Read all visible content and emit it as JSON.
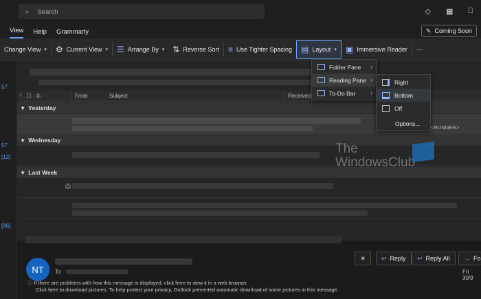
{
  "search": {
    "placeholder": "Search"
  },
  "menubar": {
    "items": [
      "View",
      "Help",
      "Grammarly"
    ],
    "coming_soon": "Coming Soon"
  },
  "ribbon": {
    "change_view": "Change View",
    "current_view": "Current View",
    "arrange_by": "Arrange By",
    "reverse_sort": "Reverse Sort",
    "tighter_spacing": "Use Tighter Spacing",
    "layout": "Layout",
    "immersive_reader": "Immersive Reader",
    "more": "···"
  },
  "layout_menu": {
    "folder_pane": "Folder Pane",
    "reading_pane": "Reading Pane",
    "todo_bar": "To-Do Bar"
  },
  "reading_pane_menu": {
    "right": "Right",
    "bottom": "Bottom",
    "off": "Off",
    "options": "Options..."
  },
  "columns": {
    "from": "From",
    "subject": "Subject",
    "received": "Received"
  },
  "groups": {
    "yesterday": "Yesterday",
    "wednesday": "Wednesday",
    "last_week": "Last Week"
  },
  "runner_text": ": <RUNNER>",
  "left_counts": {
    "c1": "57",
    "c2": "57",
    "c3": "[12]",
    "c4": "[86]"
  },
  "watermark": {
    "line1": "The",
    "line2": "WindowsClub"
  },
  "reading_pane": {
    "avatar": "NT",
    "to_label": "To",
    "reply": "Reply",
    "reply_all": "Reply All",
    "forward": "Fo",
    "date": "Fri 30/9",
    "info_line1": "If there are problems with how this message is displayed, click here to view it in a web browser.",
    "info_line2": "Click here to download pictures. To help protect your privacy, Outlook prevented automatic download of some pictures in this message."
  }
}
